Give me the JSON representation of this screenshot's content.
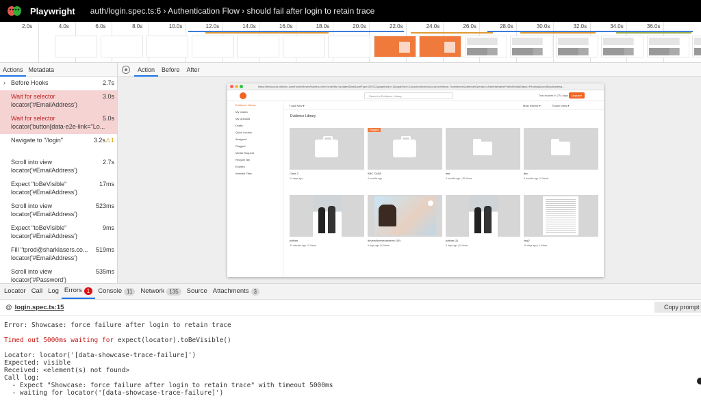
{
  "header": {
    "app_name": "Playwright",
    "breadcrumb": "auth/login.spec.ts:6 › Authentication Flow › should fail after login to retain trace"
  },
  "timeline": {
    "ticks": [
      "2.0s",
      "4.0s",
      "6.0s",
      "8.0s",
      "10.0s",
      "12.0s",
      "14.0s",
      "16.0s",
      "18.0s",
      "20.0s",
      "22.0s",
      "24.0s",
      "26.0s",
      "28.0s",
      "30.0s",
      "32.0s",
      "34.0s",
      "36.0s"
    ]
  },
  "left_tabs": {
    "actions": "Actions",
    "metadata": "Metadata"
  },
  "actions": [
    {
      "title": "Before Hooks",
      "duration": "2.7s",
      "locator": "",
      "error": false,
      "caret": "›"
    },
    {
      "title": "Wait for selector",
      "duration": "3.0s",
      "locator": "locator('#EmailAddress')",
      "error": true
    },
    {
      "title": "Wait for selector",
      "duration": "5.0s",
      "locator": "locator('button[data-e2e-link=\"Lo...",
      "error": true
    },
    {
      "title": "Navigate to \"/login\"",
      "duration": "3.2s",
      "locator": "",
      "error": false,
      "warn": "⚠1"
    },
    {
      "title": "Scroll into view",
      "duration": "2.7s",
      "locator": "locator('#EmailAddress')",
      "error": false
    },
    {
      "title": "Expect \"toBeVisible\"",
      "duration": "17ms",
      "locator": "locator('#EmailAddress')",
      "error": false
    },
    {
      "title": "Scroll into view",
      "duration": "523ms",
      "locator": "locator('#EmailAddress')",
      "error": false
    },
    {
      "title": "Expect \"toBeVisible\"",
      "duration": "9ms",
      "locator": "locator('#EmailAddress')",
      "error": false
    },
    {
      "title": "Fill \"tprod@sharklasers.co...",
      "duration": "519ms",
      "locator": "locator('#EmailAddress')",
      "error": false
    },
    {
      "title": "Scroll into view",
      "duration": "535ms",
      "locator": "locator('#Password')",
      "error": false
    }
  ],
  "right_tabs": {
    "action": "Action",
    "before": "Before",
    "after": "After"
  },
  "snapshot": {
    "url": "https://beta.prod.vidizmo.com/home/library/thumbs-view?orderBy=UpdatedDate&sortType=DESC&pageIndex=1&pageSize=1&customIndex&cloud=evidence-Trueidence&AttributeOperator=AdministrativePublicMediaStatus=Pending&scrollDuplicatewa...",
    "search_placeholder": "Search in Evidence Library",
    "trial": "Trial expires in 274 days",
    "upgrade": "Upgrade",
    "sidebar": [
      "Evidence Library",
      "My Cases",
      "My Uploads",
      "Drafts",
      "Quick Access",
      "Assigned",
      "Flagged",
      "Media Request",
      "Recycle Bin",
      "Expired",
      "Infected Files"
    ],
    "toolbar": {
      "add_new": "+ Add New ▾",
      "sort": "Most Recent ▾",
      "view": "Thumb View ▾"
    },
    "section_title": "Evidence Library",
    "cards": [
      {
        "name": "Case 3",
        "meta": "14 days ago",
        "type": "case"
      },
      {
        "name": "ABC CASE",
        "meta": "4 months ago",
        "type": "case",
        "tag": "Flagged"
      },
      {
        "name": "test",
        "meta": "4 months ago | 15 Views",
        "type": "folder"
      },
      {
        "name": "abc",
        "meta": "3 months ago | 0 Views",
        "type": "folder"
      },
      {
        "name": "pathan",
        "meta": "42 minutes ago | 0 Views",
        "type": "photo"
      },
      {
        "name": "driverslicensesandrew (19)",
        "meta": "9 days ago | 0 Views",
        "type": "license"
      },
      {
        "name": "pathan (1)",
        "meta": "9 days ago | 0 Views",
        "type": "photo"
      },
      {
        "name": "img2",
        "meta": "15 days ago | 0 Views",
        "type": "doc"
      }
    ]
  },
  "bottom_tabs": [
    {
      "label": "Locator",
      "badge": ""
    },
    {
      "label": "Call",
      "badge": ""
    },
    {
      "label": "Log",
      "badge": ""
    },
    {
      "label": "Errors",
      "badge": "1",
      "active": true
    },
    {
      "label": "Console",
      "badge": "11"
    },
    {
      "label": "Network",
      "badge": "135"
    },
    {
      "label": "Source",
      "badge": ""
    },
    {
      "label": "Attachments",
      "badge": "3"
    }
  ],
  "error": {
    "at": "@",
    "file": "login.spec.ts:15",
    "copy_prompt": "Copy prompt",
    "line1": "Error: Showcase: force failure after login to retain trace",
    "timeout_prefix": "Timed out 5000ms waiting for ",
    "timeout_expr": "expect(locator).toBeVisible()",
    "locator_line": "Locator: locator('[data-showcase-trace-failure]')",
    "expected": "Expected: visible",
    "received": "Received: <element(s) not found>",
    "call_log": "Call log:",
    "log1": "  - Expect \"Showcase: force failure after login to retain trace\" with timeout 5000ms",
    "log2": "  - waiting for locator('[data-showcase-trace-failure]')"
  },
  "colors": {
    "accent": "#1a73e8",
    "error_bg": "#f6d3d3",
    "error_text": "#c41a16",
    "brand_orange": "#f26522"
  }
}
